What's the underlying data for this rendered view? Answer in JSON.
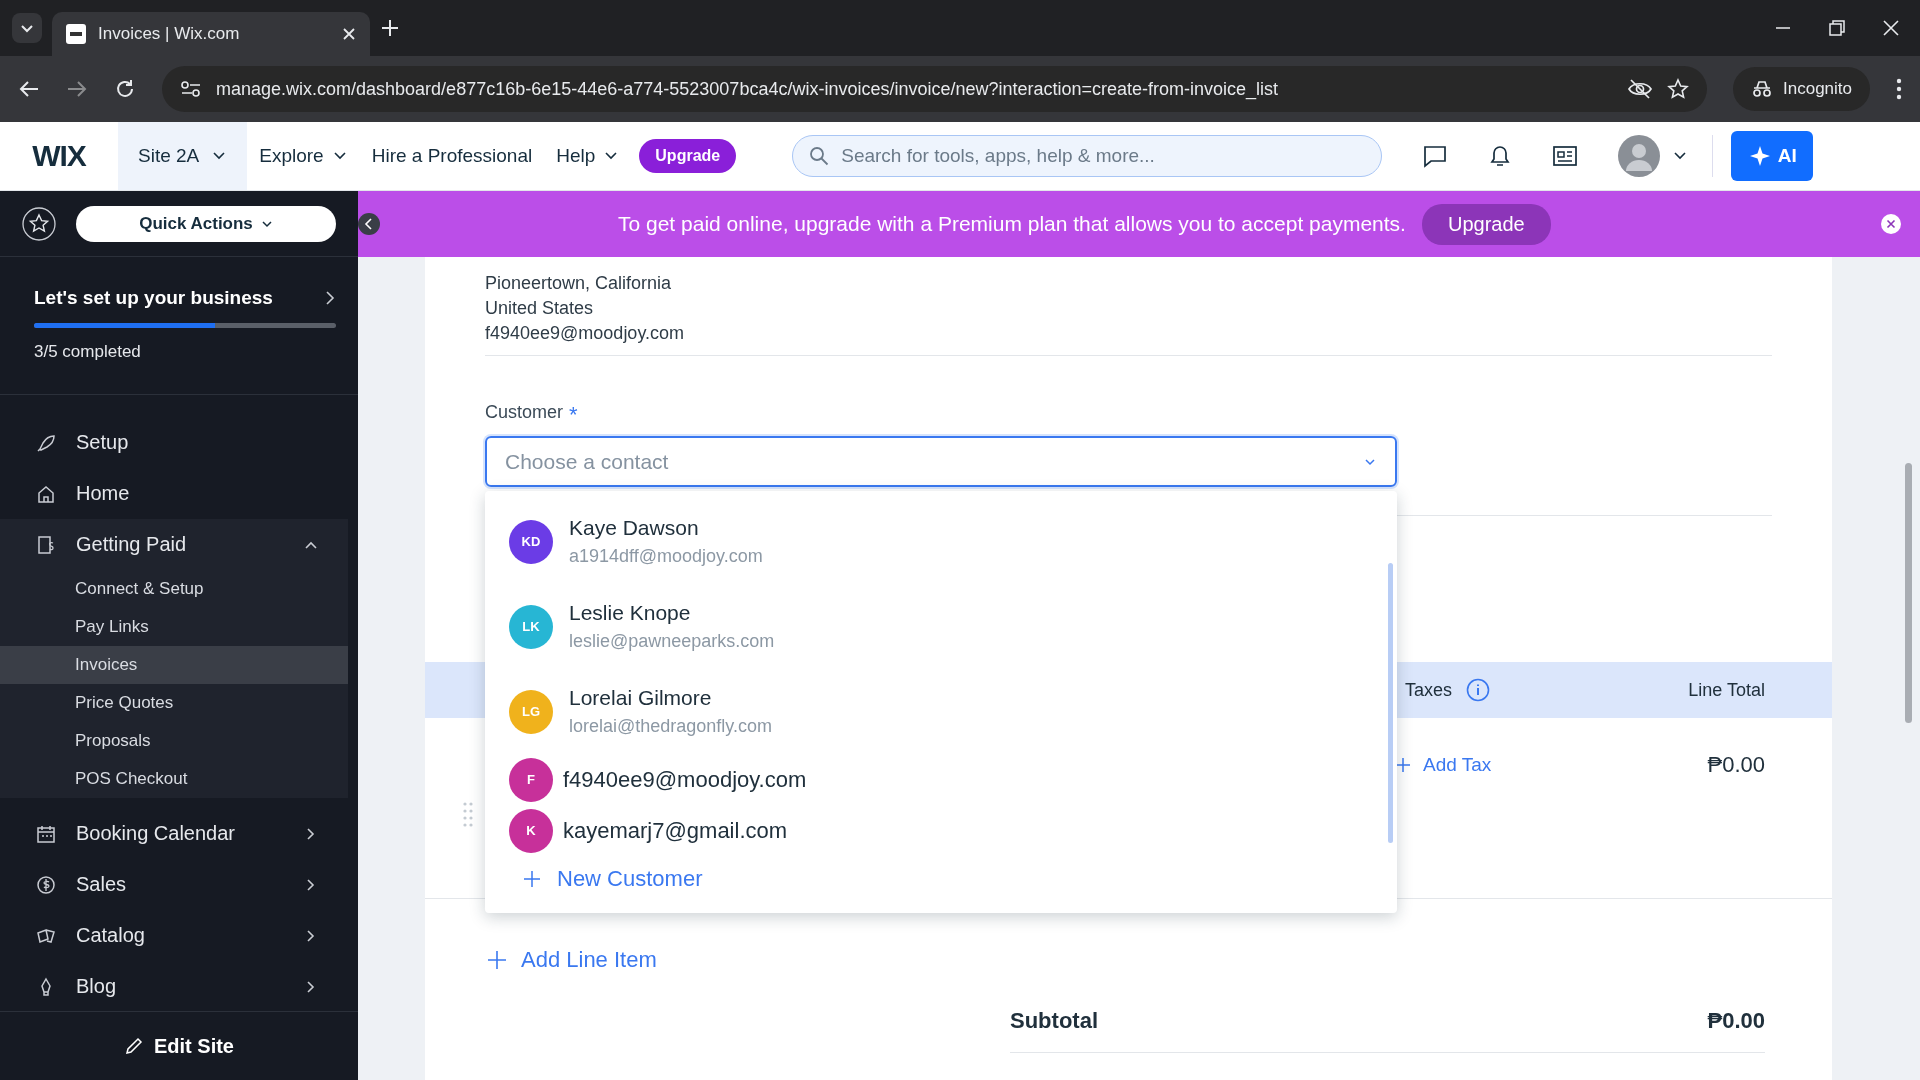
{
  "browser": {
    "tab_title": "Invoices | Wix.com",
    "url": "manage.wix.com/dashboard/e877c16b-6e15-44e6-a774-5523007bca4c/wix-invoices/invoice/new?interaction=create-from-invoice_list",
    "profile": "Incognito"
  },
  "header": {
    "logo": "WIX",
    "site": "Site 2A",
    "nav": [
      {
        "label": "Explore",
        "dropdown": true
      },
      {
        "label": "Hire a Professional",
        "dropdown": false
      },
      {
        "label": "Help",
        "dropdown": true
      }
    ],
    "upgrade": "Upgrade",
    "search": {
      "placeholder": "Search for tools, apps, help & more..."
    },
    "ai": "AI"
  },
  "banner": {
    "message": "To get paid online, upgrade with a Premium plan that allows you to accept payments.",
    "button": "Upgrade"
  },
  "sidebar": {
    "quick_actions": "Quick Actions",
    "setup": {
      "title": "Let's set up your business",
      "level": 0.6,
      "progress_text": "3/5 completed"
    },
    "items": [
      {
        "label": "Setup"
      },
      {
        "label": "Home"
      },
      {
        "label": "Getting Paid",
        "expanded": true,
        "children": [
          {
            "label": "Connect & Setup",
            "selected": false
          },
          {
            "label": "Pay Links",
            "selected": false
          },
          {
            "label": "Invoices",
            "selected": true
          },
          {
            "label": "Price Quotes",
            "selected": false
          },
          {
            "label": "Proposals",
            "selected": false
          },
          {
            "label": "POS Checkout",
            "selected": false
          }
        ]
      },
      {
        "label": "Booking Calendar",
        "expanded": false
      },
      {
        "label": "Sales",
        "expanded": false
      },
      {
        "label": "Catalog",
        "expanded": false
      },
      {
        "label": "Blog",
        "expanded": false
      }
    ],
    "edit_site": "Edit Site"
  },
  "form": {
    "address_lines": [
      "Pioneertown, California",
      "United States",
      "f4940ee9@moodjoy.com"
    ],
    "customer": {
      "label": "Customer",
      "required_mark": "*",
      "placeholder": "Choose a contact",
      "contacts": [
        {
          "kind": "named",
          "initials": "KD",
          "name": "Kaye Dawson",
          "email": "a1914dff@moodjoy.com",
          "color": "#6b3ce6"
        },
        {
          "kind": "named",
          "initials": "LK",
          "name": "Leslie Knope",
          "email": "leslie@pawneeparks.com",
          "color": "#27b6d4"
        },
        {
          "kind": "named",
          "initials": "LG",
          "name": "Lorelai Gilmore",
          "email": "lorelai@thedragonfly.com",
          "color": "#f0b21c"
        },
        {
          "kind": "email",
          "initials": "F",
          "email": "f4940ee9@moodjoy.com",
          "color": "#c7309a"
        },
        {
          "kind": "email",
          "initials": "K",
          "email": "kayemarj7@gmail.com",
          "color": "#c7309a"
        }
      ],
      "new_customer": "New Customer"
    },
    "table": {
      "columns": [
        {
          "label": "Taxes",
          "info": true
        },
        {
          "label": "Line Total",
          "info": false
        }
      ],
      "row": {
        "add_tax": "Add Tax",
        "total": "₱0.00"
      }
    },
    "add_line_item": "Add Line Item",
    "subtotal": {
      "label": "Subtotal",
      "value": "₱0.00"
    }
  }
}
